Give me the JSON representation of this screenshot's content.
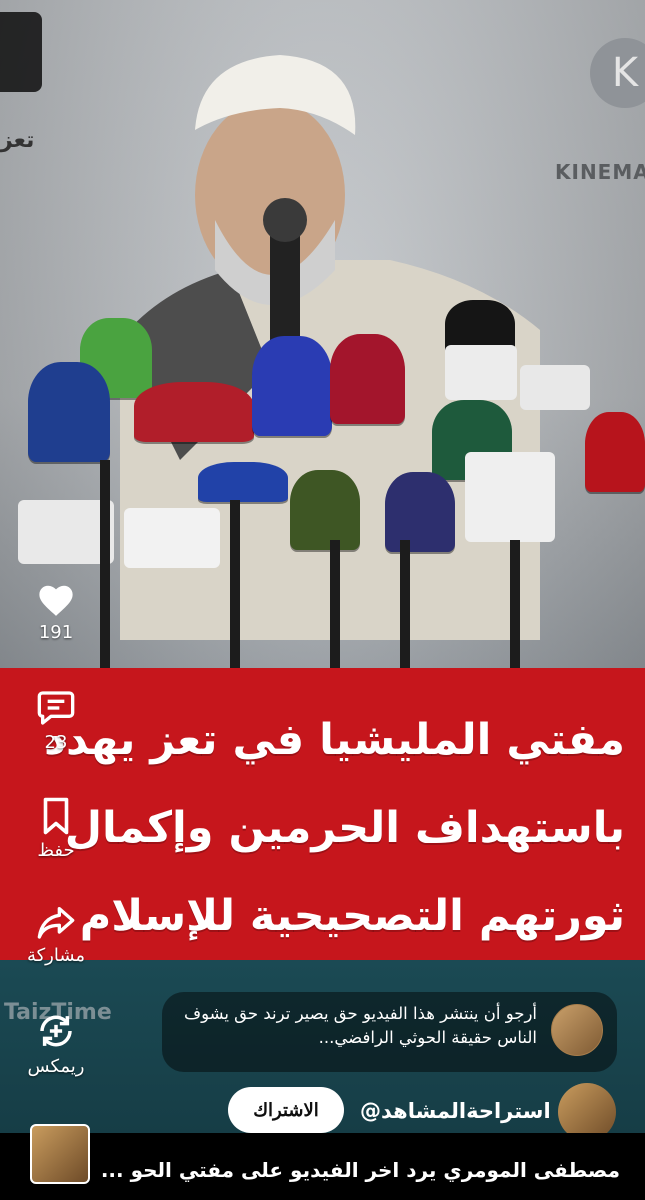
{
  "video": {
    "watermark_right": "KINEMA",
    "watermark_left": "تعز",
    "caption_lines": [
      "مفتي المليشيا في تعز يهدد",
      "باستهداف الحرمين وإكمال",
      "ثورتهم التصحيحية للإسلام"
    ],
    "source_watermark": "TaizTime"
  },
  "actions": {
    "like_count": "191",
    "comments_count": "23",
    "save_label": "حفظ",
    "share_label": "مشاركة",
    "remix_label": "ريمكس"
  },
  "pinned_comment": {
    "text": "أرجو أن ينتشر هذا الفيديو حق يصير ترند حق يشوف الناس حقيقة الحوثي الرافضي..."
  },
  "channel": {
    "name": "@استراحةالمشاهد",
    "subscribe_label": "الاشتراك"
  },
  "next_video": {
    "title": "مصطفى المومري يرد اخر الفيديو على مفتي الحو ..."
  },
  "colors": {
    "caption_red": "#c6161c",
    "lower_teal": "#1b4a54"
  }
}
